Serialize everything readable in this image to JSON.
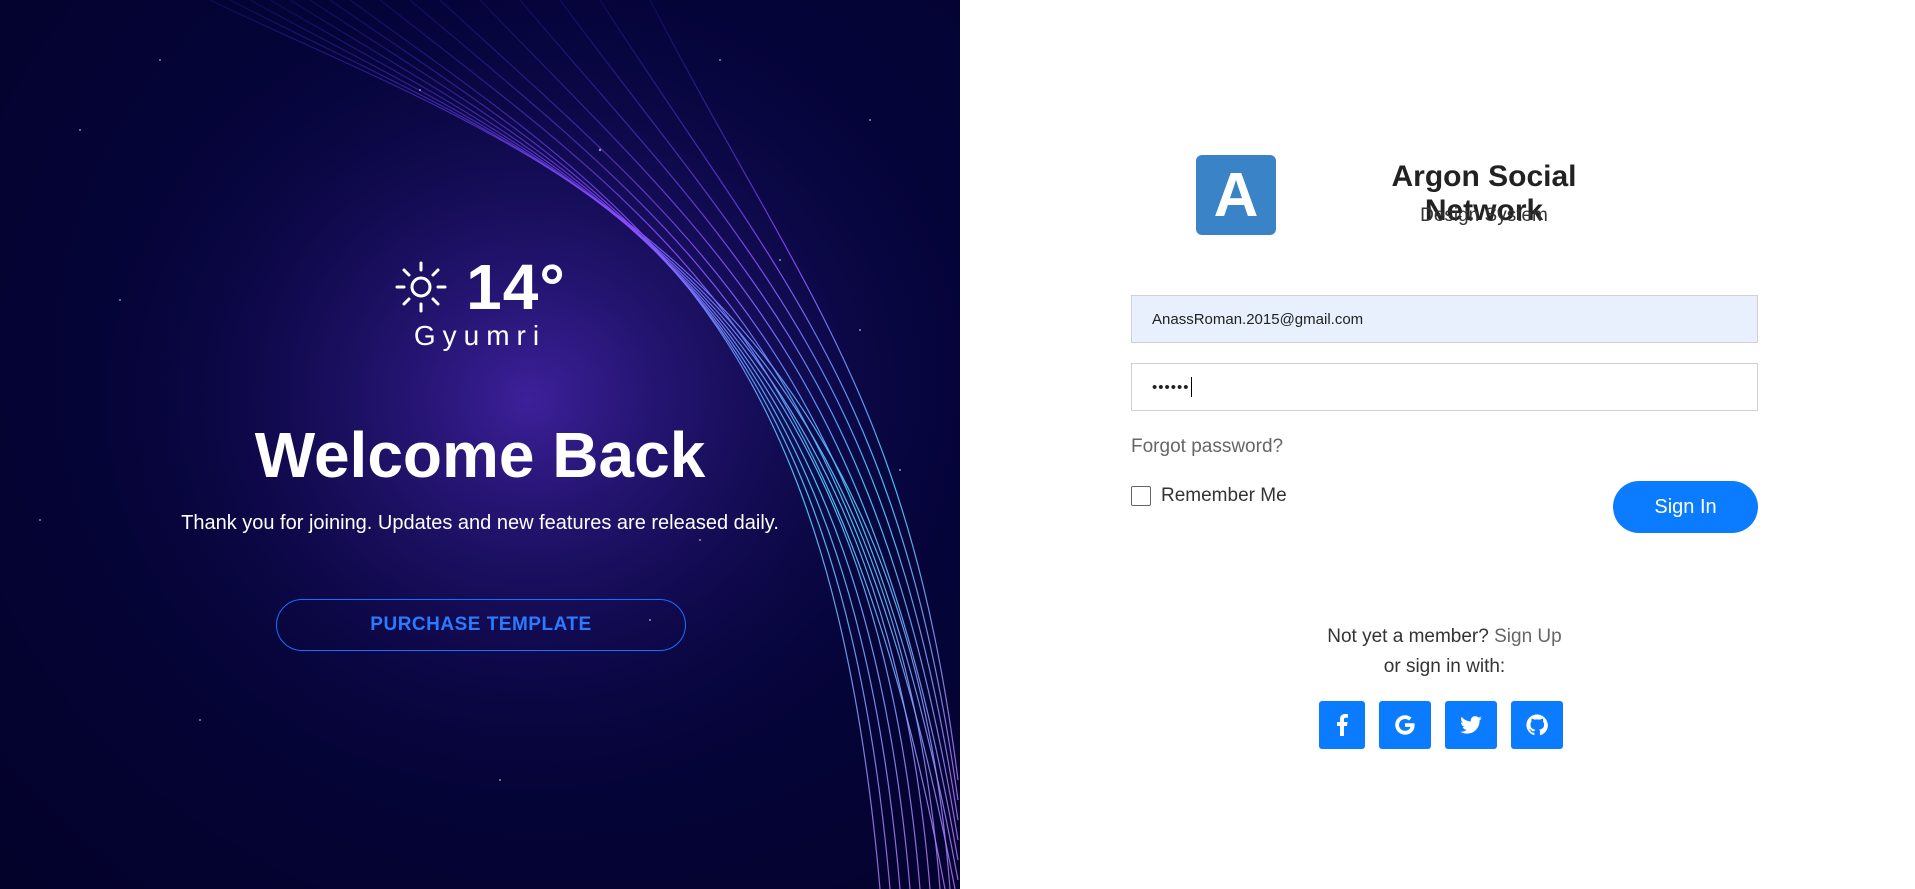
{
  "hero": {
    "temperature": "14°",
    "city": "Gyumri",
    "title": "Welcome Back",
    "tagline": "Thank you for joining. Updates and new features are released daily.",
    "cta_label": "PURCHASE TEMPLATE",
    "weather_icon": "sun-icon"
  },
  "brand": {
    "logo_letter": "A",
    "title": "Argon Social Network",
    "subtitle": "Design System"
  },
  "form": {
    "email_value": "AnassRoman.2015@gmail.com",
    "password_value": "••••••",
    "forgot_label": "Forgot password?",
    "remember_label": "Remember Me",
    "signin_label": "Sign In"
  },
  "footer": {
    "member_text": "Not yet a member?",
    "signup_label": "Sign Up",
    "alt_text": "or sign in with:",
    "socials": [
      "facebook-icon",
      "google-icon",
      "twitter-icon",
      "github-icon"
    ]
  },
  "colors": {
    "primary": "#0b7cff",
    "logo": "#3a83c6",
    "hero_bg": "#05043a"
  }
}
